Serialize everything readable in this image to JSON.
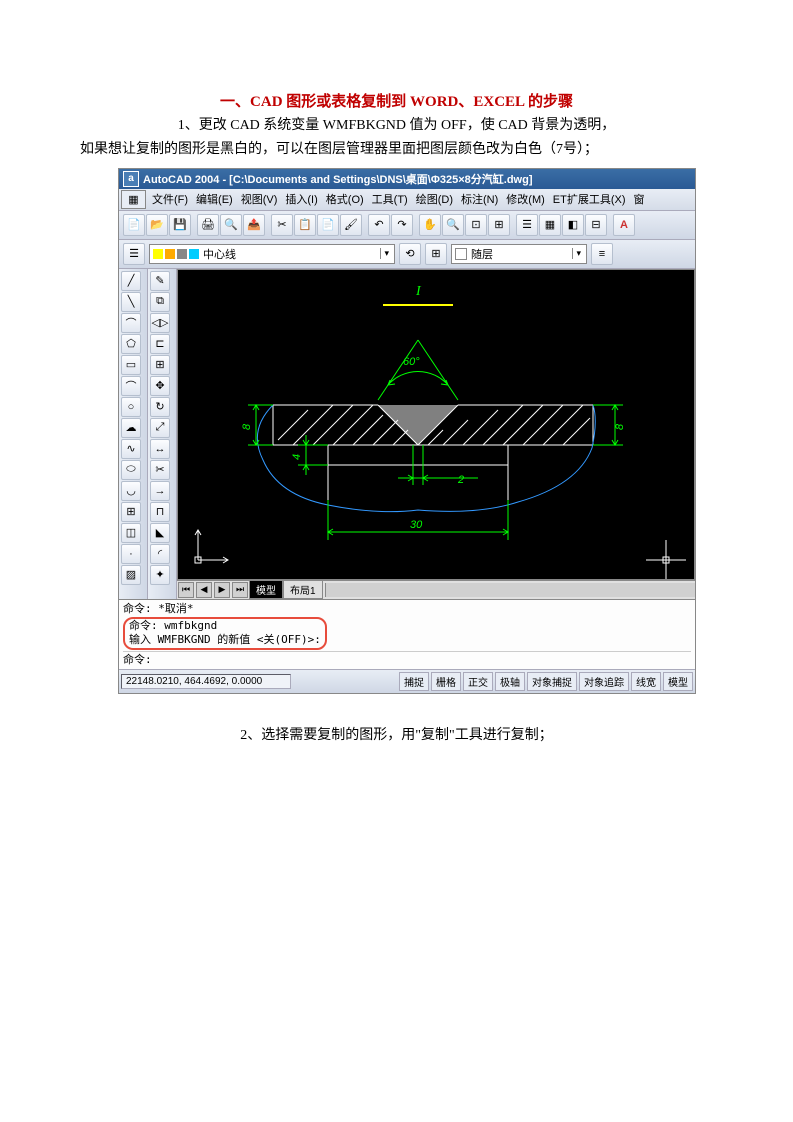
{
  "title": "一、CAD 图形或表格复制到 WORD、EXCEL 的步骤",
  "step1_line1": "1、更改 CAD 系统变量 WMFBKGND 值为 OFF，使 CAD 背景为透明，",
  "step1_line2": "如果想让复制的图形是黑白的，可以在图层管理器里面把图层颜色改为白色（7号）；",
  "step2": "2、选择需要复制的图形，用\"复制\"工具进行复制；",
  "cad": {
    "window_title": "AutoCAD 2004 - [C:\\Documents and Settings\\DNS\\桌面\\Φ325×8分汽缸.dwg]",
    "app_icon_letter": "a",
    "menu": {
      "file": "文件(F)",
      "edit": "编辑(E)",
      "view": "视图(V)",
      "insert": "插入(I)",
      "format": "格式(O)",
      "tools": "工具(T)",
      "draw": "绘图(D)",
      "dimension": "标注(N)",
      "modify": "修改(M)",
      "et_ext": "ET扩展工具(X)",
      "window": "窗"
    },
    "layer": {
      "current": "中心线",
      "bylayer": "随层"
    },
    "tabs": {
      "model": "模型",
      "layout1": "布局1"
    },
    "cmd": {
      "cancel": "命令:  *取消*",
      "line1": "命令:  wmfbkgnd",
      "line2": "输入 WMFBKGND 的新值 <关(OFF)>:",
      "prompt": "命令:"
    },
    "status": {
      "coords": "22148.0210, 464.4692, 0.0000",
      "snap": "捕捉",
      "grid": "栅格",
      "ortho": "正交",
      "polar": "极轴",
      "osnap": "对象捕捉",
      "otrack": "对象追踪",
      "lwt": "线宽",
      "model": "模型"
    },
    "drawing": {
      "angle": "60°",
      "dim_h1": "8",
      "dim_h2": "8",
      "dim_v": "4",
      "dim_gap": "2",
      "dim_width": "30",
      "annotation": "I"
    }
  }
}
